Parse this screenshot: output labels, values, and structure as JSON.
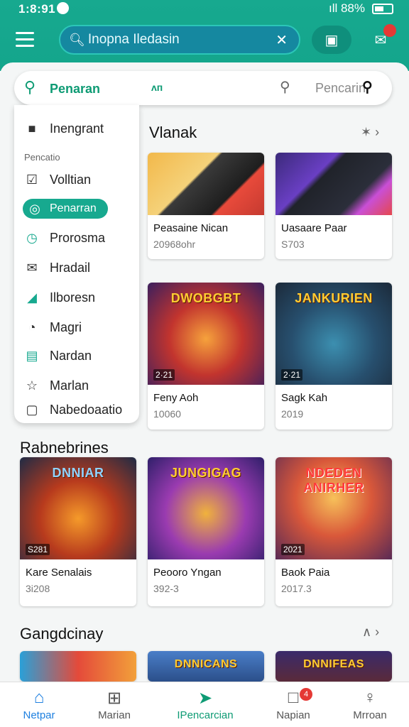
{
  "status": {
    "time": "1:8:91",
    "signal": "ıll 88%"
  },
  "top_search": {
    "text": "Inopna Iledasin"
  },
  "search_row": {
    "label": "Penaran",
    "mid": "ᴧᴨ",
    "placeholder": "Pencarin"
  },
  "drawer": {
    "section_label": "Pencatio",
    "items": [
      {
        "label": "Inengrant",
        "icon": "bag-icon"
      },
      {
        "label": "Volltian",
        "icon": "checkbox-icon"
      },
      {
        "label": "Penarran",
        "icon": "globe-icon",
        "active": true
      },
      {
        "label": "Prorosma",
        "icon": "clock-icon"
      },
      {
        "label": "Hradail",
        "icon": "mail-icon"
      },
      {
        "label": "Ilboresn",
        "icon": "chart-icon"
      },
      {
        "label": "Magri",
        "icon": "compass-icon"
      },
      {
        "label": "Nardan",
        "icon": "list-icon"
      },
      {
        "label": "Marlan",
        "icon": "star-icon"
      },
      {
        "label": "Nabedoaatio",
        "icon": "square-icon"
      }
    ]
  },
  "section1": {
    "title": "Vlanak",
    "cards": [
      {
        "title": "Peasaine Nican",
        "sub": "20968ohr"
      },
      {
        "title": "Uasaare Paar",
        "sub": "S703"
      },
      {
        "title": "Feny Aoh",
        "sub": "10060",
        "tag": "2·21",
        "art": "DWOBGBT"
      },
      {
        "title": "Sagk Kah",
        "sub": "2019",
        "tag": "2·21",
        "art": "JANKURIEN"
      }
    ]
  },
  "section2": {
    "title": "Rabnebrines",
    "cards": [
      {
        "title": "Kare Senalais",
        "sub": "3i208",
        "tag": "S281",
        "art": "DNNIAR"
      },
      {
        "title": "Peooro Yngan",
        "sub": "392-3",
        "tag": "",
        "art": "JUNGIGAG"
      },
      {
        "title": "Baok Paia",
        "sub": "2017.3",
        "tag": "2021",
        "art": "NDEDEN ANIRHER"
      }
    ]
  },
  "section3": {
    "title": "Gangdcinay",
    "cards": [
      {
        "art": ""
      },
      {
        "art": "DNNICANS"
      },
      {
        "art": "DNNIFEAS"
      }
    ]
  },
  "bottom_nav": [
    {
      "label": "Netpar",
      "icon": "home-icon",
      "active": true
    },
    {
      "label": "Marian",
      "icon": "grid-icon"
    },
    {
      "label": "IPencarcian",
      "icon": "send-icon",
      "active2": true
    },
    {
      "label": "Napian",
      "icon": "chat-icon",
      "badge": "4"
    },
    {
      "label": "Mrroan",
      "icon": "person-icon"
    }
  ],
  "colors": {
    "primary": "#17a98f",
    "accent_blue": "#1f80e0",
    "active_green": "#0e9b74"
  }
}
